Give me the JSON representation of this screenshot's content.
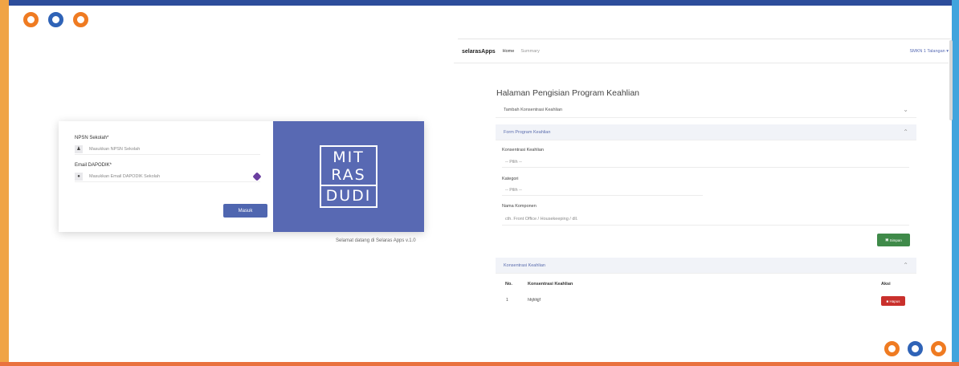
{
  "login": {
    "npsn_label": "NPSN Sekolah*",
    "npsn_placeholder": "Masukkan NPSN Sekolah",
    "email_label": "Email DAPODIK*",
    "email_placeholder": "Masukkan Email DAPODIK Sekolah",
    "submit_label": "Masuk",
    "brand_line1": "MIT",
    "brand_line2": "RAS",
    "brand_line3": "DUDI",
    "welcome_text": "Selamat datang di Selaras Apps v.1.0"
  },
  "app": {
    "brand": "selarasApps",
    "nav": [
      "Home",
      "Summary"
    ],
    "user": "SMKN 1 Talangan ▾",
    "page_title": "Halaman Pengisian Program Keahlian",
    "accordion_add": "Tambah Konsentrasi Keahlian",
    "accordion_form": "Form Program Keahlian",
    "field_konsentrasi_label": "Konsentrasi Keahlian",
    "field_konsentrasi_value": "-- Pilih --",
    "field_kategori_label": "Kategori",
    "field_kategori_value": "-- Pilih --",
    "field_komponen_label": "Nama Komponen",
    "field_komponen_placeholder": "cth. Front Office / Housekeeping / dll.",
    "save_label": "Simpan",
    "accordion_list": "Konsentrasi Keahlian",
    "table": {
      "headers": [
        "No.",
        "Konsentrasi Keahlian",
        "Aksi"
      ],
      "rows": [
        {
          "no": "1",
          "name": "hhjhhjjf",
          "action": "Hapus"
        }
      ]
    }
  },
  "colors": {
    "frame_top": "#2d4d9b",
    "frame_left": "#f0a445",
    "frame_right": "#41a4dd",
    "frame_bottom": "#e9713e",
    "brand_panel": "#5869b3",
    "save_button": "#3f8a49",
    "delete_button": "#c9302c"
  }
}
